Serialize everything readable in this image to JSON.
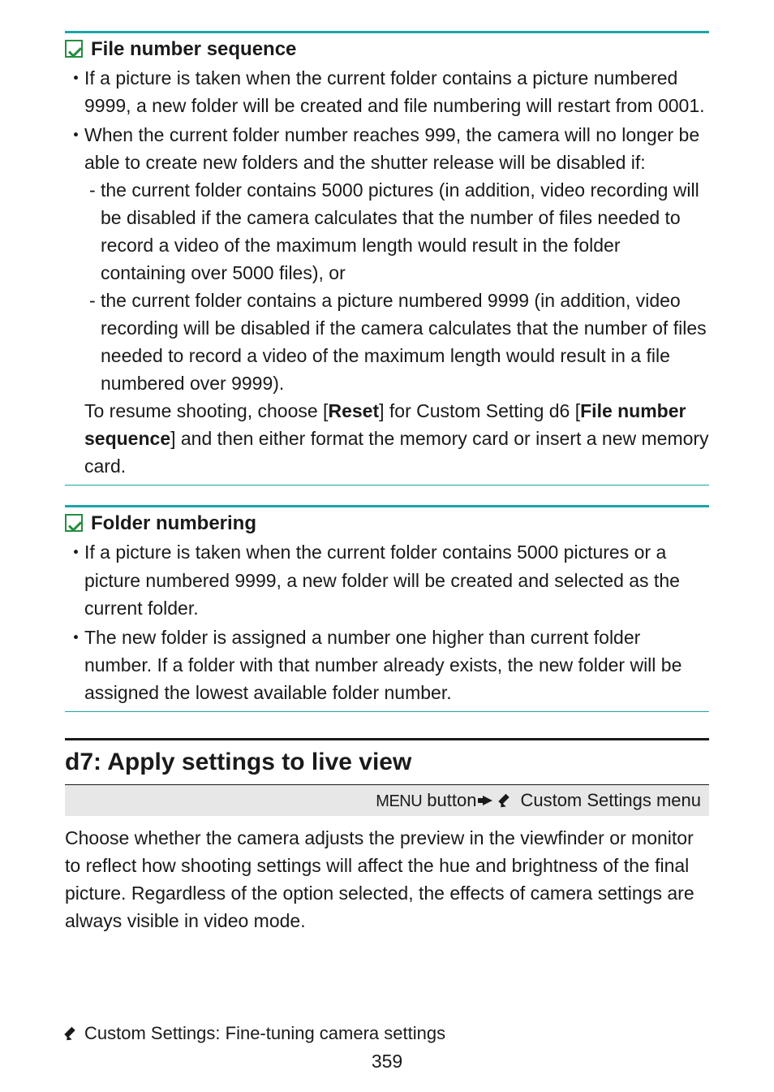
{
  "info1": {
    "title": "File number sequence",
    "bullets": [
      {
        "text": "If a picture is taken when the current folder contains a picture numbered 9999, a new folder will be created and file numbering will restart from 0001."
      },
      {
        "text": "When the current folder number reaches 999, the camera will no longer be able to create new folders and the shutter release will be disabled if:",
        "dashes": [
          "the current folder contains 5000 pictures (in addition, video recording will be disabled if the camera calculates that the number of files needed to record a video of the maximum length would result in the folder containing over 5000 files), or",
          "the current folder contains a picture numbered 9999 (in addition, video recording will be disabled if the camera calculates that the number of files needed to record a video of the maximum length would result in a file numbered over 9999)."
        ],
        "trailer_parts": [
          {
            "t": "To resume shooting, choose [",
            "b": false
          },
          {
            "t": "Reset",
            "b": true
          },
          {
            "t": "] for Custom Setting d6 [",
            "b": false
          },
          {
            "t": "File number sequence",
            "b": true
          },
          {
            "t": "] and then either format the memory card or insert a new memory card.",
            "b": false
          }
        ]
      }
    ]
  },
  "info2": {
    "title": "Folder numbering",
    "bullets": [
      {
        "text": "If a picture is taken when the current folder contains 5000 pictures or a picture numbered 9999, a new folder will be created and selected as the current folder."
      },
      {
        "text": "The new folder is assigned a number one higher than current folder number. If a folder with that number already exists, the new folder will be assigned the lowest available folder number."
      }
    ]
  },
  "section": {
    "title": "d7: Apply settings to live view",
    "nav_menu": "MENU",
    "nav_button": " button",
    "nav_dest": "Custom Settings menu",
    "body": "Choose whether the camera adjusts the preview in the viewfinder or monitor to reflect how shooting settings will affect the hue and brightness of the final picture. Regardless of the option selected, the effects of camera settings are always visible in video mode."
  },
  "footer": {
    "chapter": "Custom Settings: Fine-tuning camera settings",
    "page": "359"
  }
}
